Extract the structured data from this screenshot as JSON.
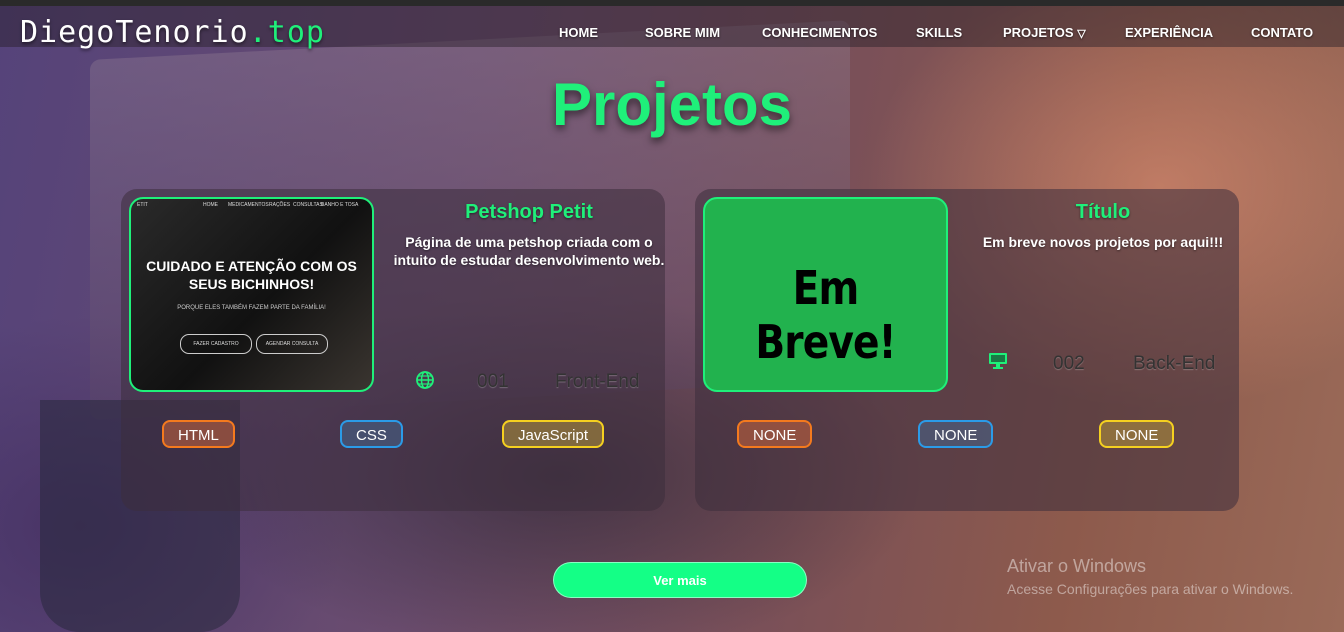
{
  "logo": {
    "name": "DiegoTenorio",
    "tld": ".top"
  },
  "nav": {
    "items": [
      "HOME",
      "SOBRE MIM",
      "CONHECIMENTOS",
      "SKILLS",
      "PROJETOS",
      "EXPERIÊNCIA",
      "CONTATO"
    ],
    "dropdown_caret": "▽"
  },
  "section_title": "Projetos",
  "projects": [
    {
      "title": "Petshop Petit",
      "description": "Página de uma petshop criada com o intuito de estudar desenvolvimento web.",
      "number": "001",
      "type": "Front-End",
      "type_icon": "globe-icon",
      "tags": [
        "HTML",
        "CSS",
        "JavaScript"
      ],
      "thumbnail": {
        "brand": "ETIT",
        "menu": [
          "HOME",
          "MEDICAMENTOS",
          "RAÇÕES",
          "CONSULTAS",
          "BANHO E TOSA"
        ],
        "headline": "CUIDADO E ATENÇÃO COM OS SEUS BICHINHOS!",
        "subline": "PORQUE ELES TAMBÉM FAZEM PARTE DA FAMÍLIA!",
        "buttons": [
          "FAZER CADASTRO",
          "AGENDAR CONSULTA"
        ]
      }
    },
    {
      "title": "Título",
      "description": "Em breve novos projetos por aqui!!!",
      "number": "002",
      "type": "Back-End",
      "type_icon": "monitor-icon",
      "tags": [
        "NONE",
        "NONE",
        "NONE"
      ],
      "thumbnail": {
        "text": "Em Breve!"
      }
    }
  ],
  "more_button": "Ver mais",
  "windows_activation": {
    "title": "Ativar o Windows",
    "subtitle": "Acesse Configurações para ativar o Windows."
  },
  "colors": {
    "accent": "#1ff07a",
    "button": "#14ff86"
  }
}
